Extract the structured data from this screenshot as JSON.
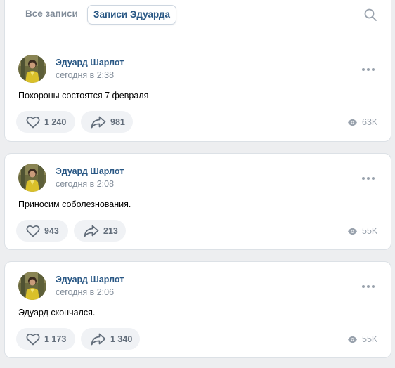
{
  "tabs": {
    "all_label": "Все записи",
    "own_label": "Записи Эдуарда"
  },
  "icons": {
    "search": "search-icon",
    "like": "heart-icon",
    "share": "share-icon",
    "views": "eye-icon",
    "more": "more-icon"
  },
  "colors": {
    "link": "#2a5885",
    "muted": "#818c99",
    "pill_bg": "#f0f2f5",
    "page_bg": "#edeef0"
  },
  "posts": [
    {
      "author": "Эдуард Шарлот",
      "time": "сегодня в 2:38",
      "text": "Похороны состоятся 7 февраля",
      "likes": "1 240",
      "shares": "981",
      "views": "63K"
    },
    {
      "author": "Эдуард Шарлот",
      "time": "сегодня в 2:08",
      "text": "Приносим соболезнования.",
      "likes": "943",
      "shares": "213",
      "views": "55K"
    },
    {
      "author": "Эдуард Шарлот",
      "time": "сегодня в 2:06",
      "text": "Эдуард скончался.",
      "likes": "1 173",
      "shares": "1 340",
      "views": "55K"
    }
  ]
}
